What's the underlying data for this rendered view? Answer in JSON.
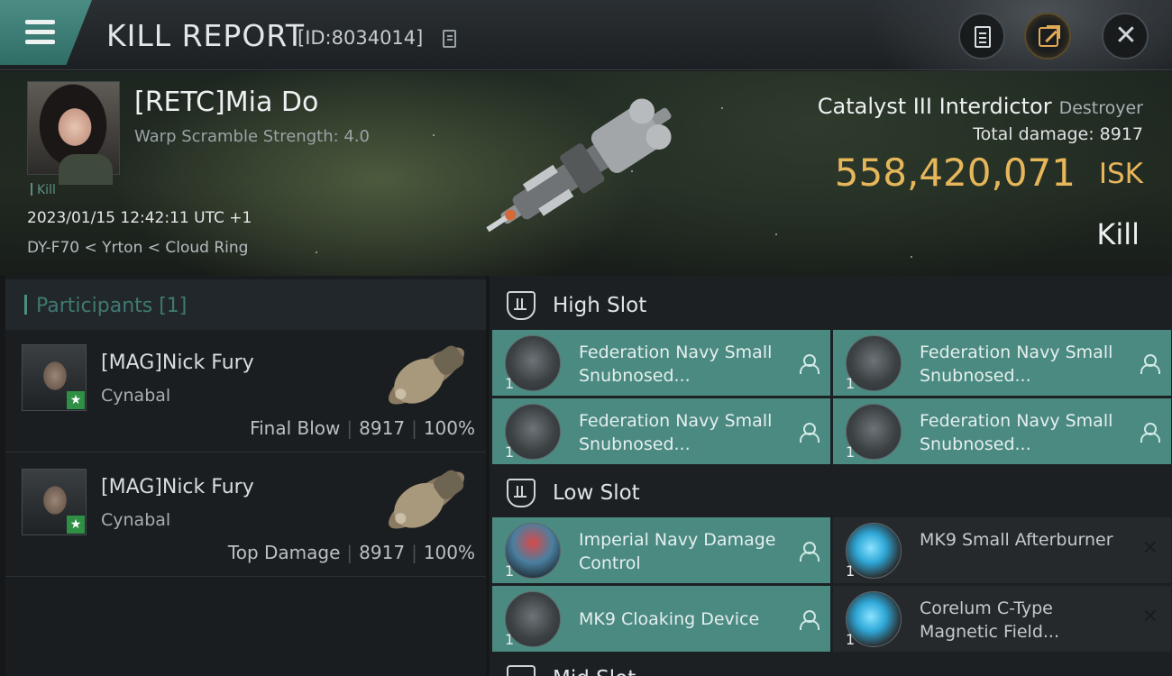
{
  "header": {
    "title": "KILL REPORT",
    "kill_id": "[ID:8034014]",
    "icons": [
      "menu-icon",
      "copy-icon",
      "clipboard-icon",
      "share-icon",
      "close-icon"
    ]
  },
  "victim": {
    "name": "[RETC]Mia Do",
    "warp_scramble": "Warp Scramble Strength: 4.0",
    "tag": "Kill",
    "timestamp": "2023/01/15 12:42:11 UTC +1",
    "location": "DY-F70 < Yrton < Cloud Ring"
  },
  "ship": {
    "name": "Catalyst III Interdictor",
    "class": "Destroyer",
    "total_damage": "Total damage:  8917",
    "isk_value": "558,420,071",
    "isk_unit": "ISK",
    "result": "Kill"
  },
  "participants": {
    "header": "Participants [1]",
    "rows": [
      {
        "name": "[MAG]Nick Fury",
        "ship": "Cynabal",
        "role": "Final Blow",
        "damage": "8917",
        "percent": "100%"
      },
      {
        "name": "[MAG]Nick Fury",
        "ship": "Cynabal",
        "role": "Top Damage",
        "damage": "8917",
        "percent": "100%"
      }
    ]
  },
  "slots": {
    "high": {
      "label": "High Slot",
      "modules": [
        {
          "qty": "1",
          "name": "Federation Navy Small Snubnosed...",
          "state": "fitted"
        },
        {
          "qty": "1",
          "name": "Federation Navy Small Snubnosed...",
          "state": "fitted"
        },
        {
          "qty": "1",
          "name": "Federation Navy Small Snubnosed...",
          "state": "fitted"
        },
        {
          "qty": "1",
          "name": "Federation Navy Small Snubnosed...",
          "state": "fitted"
        }
      ]
    },
    "low": {
      "label": "Low Slot",
      "modules": [
        {
          "qty": "1",
          "name": "Imperial Navy Damage Control",
          "state": "fitted"
        },
        {
          "qty": "1",
          "name": "MK9 Small Afterburner",
          "state": "dropped"
        },
        {
          "qty": "1",
          "name": "MK9 Cloaking Device",
          "state": "fitted"
        },
        {
          "qty": "1",
          "name": "Corelum C-Type Magnetic Field...",
          "state": "dropped"
        }
      ]
    },
    "mid": {
      "label": "Mid Slot"
    }
  },
  "colors": {
    "accent": "#4b8a81",
    "isk": "#e6b65a",
    "badge": "#2f8f45"
  }
}
